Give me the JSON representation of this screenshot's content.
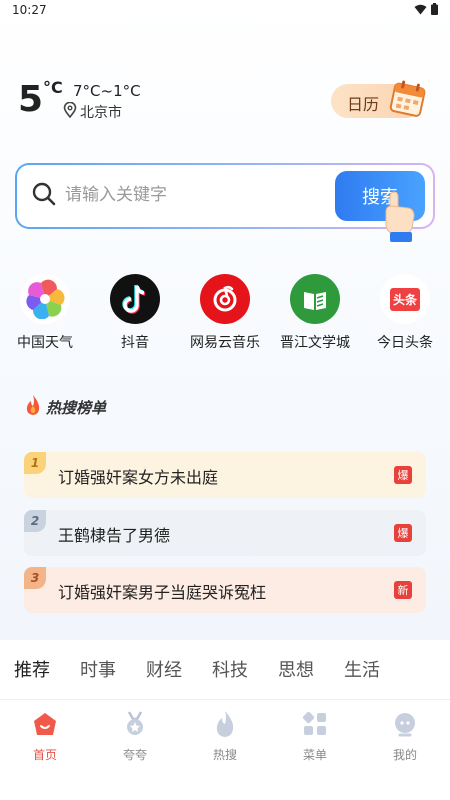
{
  "status_bar": {
    "time": "10:27",
    "icons": [
      "wifi-icon",
      "battery-icon"
    ]
  },
  "weather": {
    "temperature": "5",
    "unit": "°C",
    "range": "7°C~1°C",
    "city": "北京市"
  },
  "calendar": {
    "label": "日历"
  },
  "search": {
    "placeholder": "请输入关键字",
    "button_label": "搜索"
  },
  "apps": [
    {
      "label": "中国天气",
      "icon": "pinwheel-icon"
    },
    {
      "label": "抖音",
      "icon": "tiktok-icon"
    },
    {
      "label": "网易云音乐",
      "icon": "netease-music-icon"
    },
    {
      "label": "晋江文学城",
      "icon": "jjwxc-book-icon"
    },
    {
      "label": "今日头条",
      "icon": "toutiao-icon",
      "icon_text": "头条"
    }
  ],
  "hot_list": {
    "title": "热搜榜单",
    "items": [
      {
        "rank": "1",
        "text": "订婚强奸案女方未出庭",
        "badge": "爆"
      },
      {
        "rank": "2",
        "text": "王鹤棣告了男德",
        "badge": "爆"
      },
      {
        "rank": "3",
        "text": "订婚强奸案男子当庭哭诉冤枉",
        "badge": "新"
      }
    ]
  },
  "tabs": [
    "推荐",
    "时事",
    "财经",
    "科技",
    "思想",
    "生活"
  ],
  "bottom_nav": [
    {
      "label": "首页",
      "icon": "home-icon",
      "active": true
    },
    {
      "label": "夸夸",
      "icon": "medal-icon"
    },
    {
      "label": "热搜",
      "icon": "flame-icon"
    },
    {
      "label": "菜单",
      "icon": "menu-grid-icon"
    },
    {
      "label": "我的",
      "icon": "profile-icon"
    }
  ],
  "colors": {
    "accent_blue": "#2f7bf0",
    "hot_red": "#e8524a",
    "rank1_bg": "#fdf3e1",
    "rank2_bg": "#eef1f5",
    "rank3_bg": "#fdece3"
  }
}
